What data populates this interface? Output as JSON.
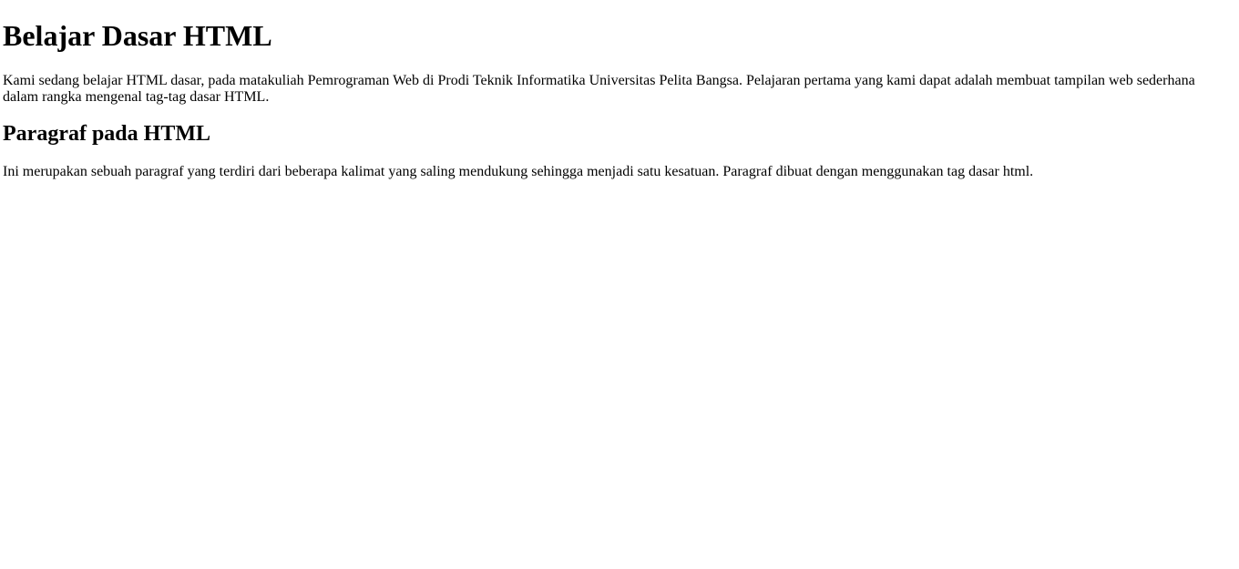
{
  "document": {
    "heading_main": "Belajar Dasar HTML",
    "intro_paragraph": "Kami sedang belajar HTML dasar, pada matakuliah Pemrograman Web di Prodi Teknik Informatika Universitas Pelita Bangsa. Pelajaran pertama yang kami dapat adalah membuat tampilan web sederhana dalam rangka mengenal tag-tag dasar HTML.",
    "heading_section": "Paragraf pada HTML",
    "section_paragraph": "Ini merupakan sebuah paragraf yang terdiri dari beberapa kalimat yang saling mendukung sehingga menjadi satu kesatuan. Paragraf dibuat dengan menggunakan tag dasar html."
  }
}
